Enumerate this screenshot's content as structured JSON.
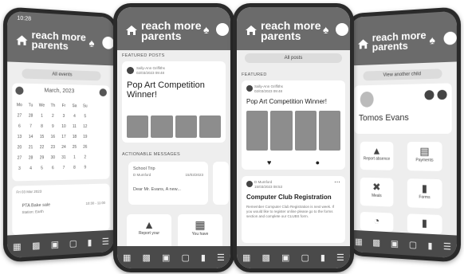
{
  "brand": {
    "line1": "reach more",
    "line2": "parents"
  },
  "status_time": "10:28",
  "phone1": {
    "all_events": "All events",
    "month": "March, 2023",
    "weekdays": [
      "Mo",
      "Tu",
      "We",
      "Th",
      "Fr",
      "Sa",
      "Su"
    ],
    "days": [
      [
        "27",
        "28",
        "1",
        "2",
        "3",
        "4",
        "5"
      ],
      [
        "6",
        "7",
        "8",
        "9",
        "10",
        "11",
        "12"
      ],
      [
        "13",
        "14",
        "15",
        "16",
        "17",
        "18",
        "19"
      ],
      [
        "20",
        "21",
        "22",
        "23",
        "24",
        "25",
        "26"
      ],
      [
        "27",
        "28",
        "29",
        "30",
        "31",
        "1",
        "2"
      ],
      [
        "3",
        "4",
        "5",
        "6",
        "7",
        "8",
        "9"
      ]
    ],
    "date_label": "Fri 03 Mar 2023",
    "event_title": "PTA Bake sale",
    "event_sub": "Station: Earth",
    "event_time": "10:30 - 11:00"
  },
  "phone2": {
    "featured_label": "FEATURED POSTS",
    "author": "Sally-Ann Griffiths",
    "date": "02/03/2023 09:48",
    "post_title": "Pop Art Competition Winner!",
    "actionable_label": "ACTIONABLE MESSAGES",
    "msg_title": "School Trip",
    "msg_author": "D Mumford",
    "msg_date": "15/03/2023",
    "msg_body": "Dear Mr. Evans, A new...",
    "tile1": "Report your",
    "tile2": "You have"
  },
  "phone3": {
    "all_posts": "All posts",
    "featured_label": "FEATURED",
    "author": "Sally-Ann Griffiths",
    "date": "02/03/2023 09:48",
    "post_title": "Pop Art Competition Winner!",
    "post2_author": "D Mumford",
    "post2_date": "15/03/2023 08:53",
    "post2_title": "Computer Club Registration",
    "post2_body": "Remember Computer Club Registration is next week. If you would like to register online please go to the forms section and complete our CLUBS form."
  },
  "phone4": {
    "view_child": "View another child",
    "child_name": "Tomos Evans",
    "tiles": [
      "Report absence",
      "Payments",
      "Meals",
      "Forms",
      "",
      ""
    ]
  },
  "tabbar_icons": [
    "grid-icon",
    "gift-icon",
    "basket-icon",
    "store-icon",
    "chat-icon",
    "menu-icon"
  ]
}
